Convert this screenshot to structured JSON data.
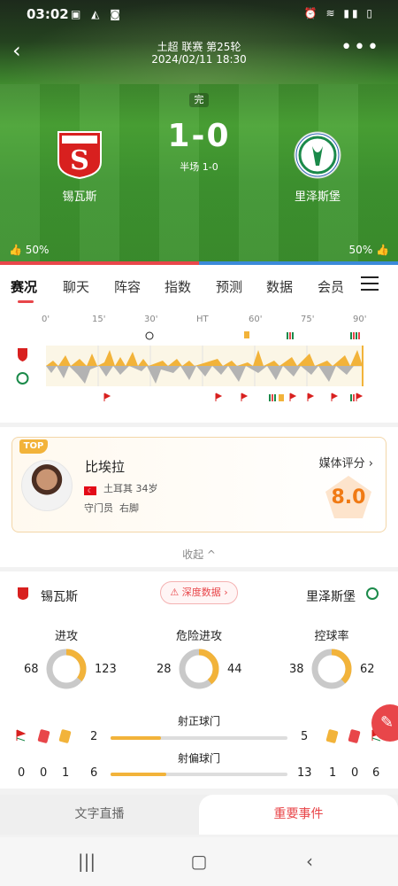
{
  "status": {
    "time": "03:02"
  },
  "match": {
    "league": "土超 联赛 第25轮",
    "datetime": "2024/02/11 18:30",
    "state": "完",
    "score": "1-0",
    "half": "半场 1-0",
    "home": {
      "name": "锡瓦斯",
      "like": "50%"
    },
    "away": {
      "name": "里泽斯堡",
      "like": "50%"
    }
  },
  "tabs": [
    "赛况",
    "聊天",
    "阵容",
    "指数",
    "预测",
    "数据",
    "会员"
  ],
  "timeline": {
    "ticks": [
      "0'",
      "15'",
      "30'",
      "HT",
      "60'",
      "75'",
      "90'"
    ]
  },
  "top_player": {
    "badge": "TOP",
    "name": "比埃拉",
    "country": "土耳其",
    "age": "34岁",
    "position": "守门员",
    "foot": "右脚",
    "media_label": "媒体评分 ›",
    "rating": "8.0",
    "collapse": "收起 ^"
  },
  "stats": {
    "home_name": "锡瓦斯",
    "away_name": "里泽斯堡",
    "deep_label": "深度数据 ›",
    "rings": [
      {
        "label": "进攻",
        "home": "68",
        "away": "123",
        "home_frac": 0.356
      },
      {
        "label": "危险进攻",
        "home": "28",
        "away": "44",
        "home_frac": 0.389
      },
      {
        "label": "控球率",
        "home": "38",
        "away": "62",
        "home_frac": 0.38
      }
    ],
    "shots_on": {
      "label": "射正球门",
      "home": "2",
      "away": "5",
      "home_frac": 0.286
    },
    "shots_off": {
      "label": "射偏球门",
      "home": "6",
      "away": "13",
      "home_frac": 0.316
    },
    "home_cards": {
      "corners": "0",
      "red": "0",
      "yellow": "1"
    },
    "away_cards": {
      "yellow": "1",
      "red": "0",
      "corners": "6"
    }
  },
  "bottom_tabs": [
    "文字直播",
    "重要事件"
  ],
  "colors": {
    "accent": "#e8464a",
    "gold": "#f2b33a",
    "away_blue": "#3b8ad9"
  }
}
